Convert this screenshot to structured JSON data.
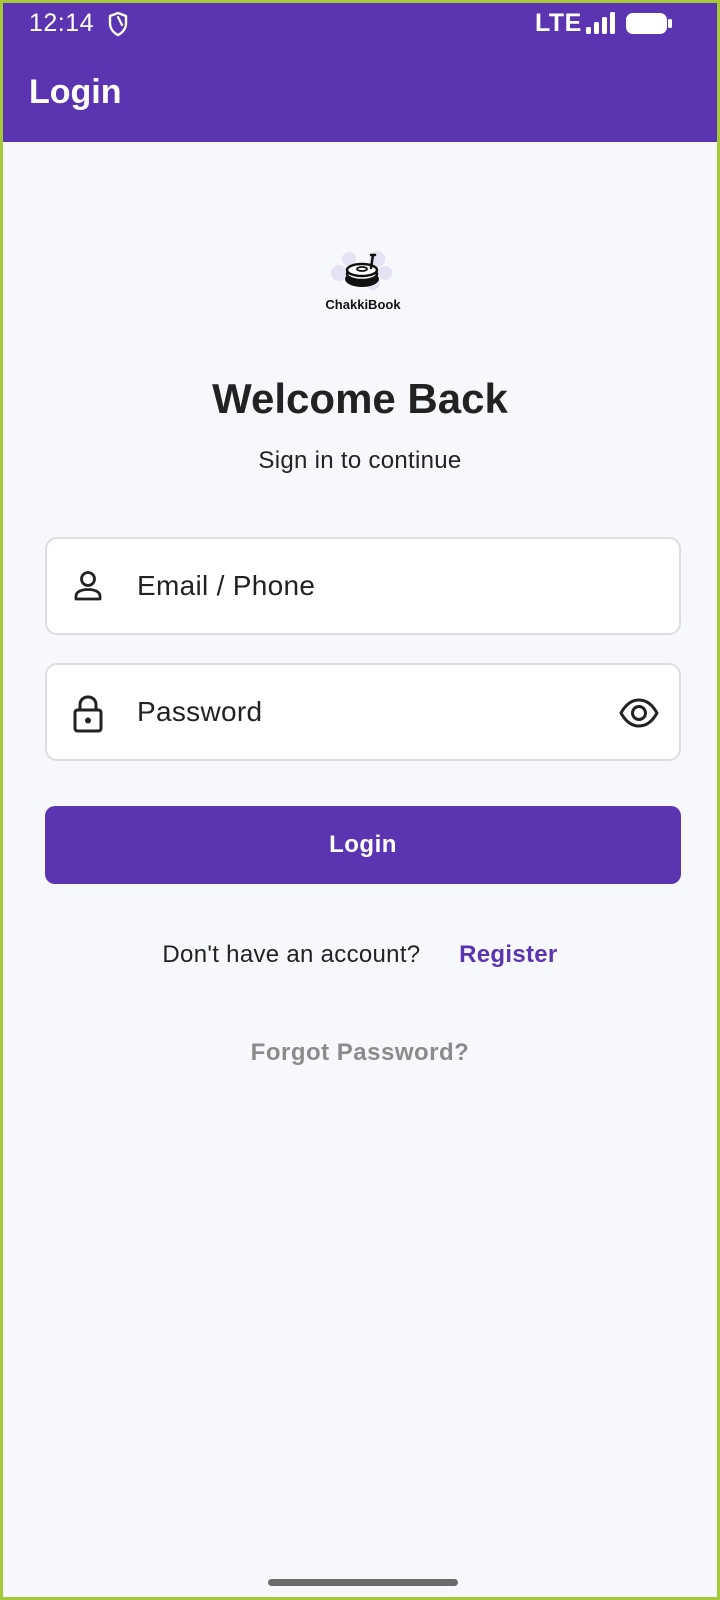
{
  "status_bar": {
    "time": "12:14",
    "network": "LTE",
    "icons": [
      "shield-icon",
      "signal-icon",
      "battery-icon"
    ]
  },
  "app_bar": {
    "title": "Login"
  },
  "logo": {
    "text": "ChakkiBook",
    "icon": "grinder-logo-icon"
  },
  "header": {
    "title": "Welcome Back",
    "subtitle": "Sign in to continue"
  },
  "form": {
    "email": {
      "placeholder": "Email / Phone",
      "value": "",
      "icon": "person-icon"
    },
    "password": {
      "placeholder": "Password",
      "value": "",
      "icon": "lock-icon",
      "toggle_icon": "eye-icon"
    },
    "login_label": "Login"
  },
  "register": {
    "prompt": "Don't have an account?",
    "link": "Register"
  },
  "forgot_password": "Forgot Password?",
  "colors": {
    "primary": "#5b35b1",
    "background": "#f7f8fb",
    "muted_text": "#8b8b8b",
    "field_border": "#dcdde2"
  }
}
